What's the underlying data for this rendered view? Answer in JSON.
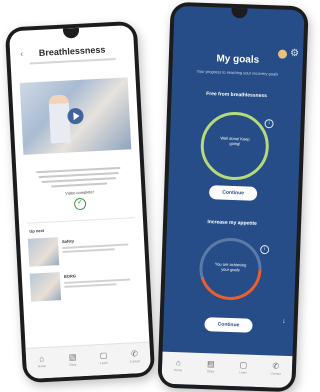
{
  "left_screen": {
    "title": "Breathlessness",
    "back_icon": "chevron-left-icon",
    "complete_label": "Video complete!",
    "check_glyph": "✓",
    "up_next_label": "Up next",
    "up_next_items": [
      {
        "name": "Safety"
      },
      {
        "name": "BORG"
      }
    ],
    "nav": [
      {
        "icon": "home-icon",
        "glyph": "⌂",
        "label": "Home"
      },
      {
        "icon": "diary-icon",
        "glyph": "▤",
        "label": "Diary"
      },
      {
        "icon": "learn-icon",
        "glyph": "▢",
        "label": "Learn"
      },
      {
        "icon": "contact-icon",
        "glyph": "✆",
        "label": "Contact"
      }
    ]
  },
  "right_screen": {
    "title": "My goals",
    "subtitle": "Your progress to reaching your recovery goals",
    "goals": [
      {
        "title": "Free from breathlessness",
        "ring_text": "Well done! Keep going!",
        "button": "Continue",
        "ring_color": "#b6d97a"
      },
      {
        "title": "Increase my appetite",
        "ring_text": "You are achieving your goals",
        "button": "Continue",
        "ring_color": "#e8612c",
        "progress": 0.45
      }
    ],
    "nav": [
      {
        "icon": "home-icon",
        "glyph": "⌂",
        "label": "Home"
      },
      {
        "icon": "diary-icon",
        "glyph": "▤",
        "label": "Diary"
      },
      {
        "icon": "learn-icon",
        "glyph": "▢",
        "label": "Learn"
      },
      {
        "icon": "contact-icon",
        "glyph": "✆",
        "label": "Contact"
      }
    ]
  },
  "colors": {
    "accent_blue": "#264d87",
    "success_green": "#3f9b48"
  }
}
